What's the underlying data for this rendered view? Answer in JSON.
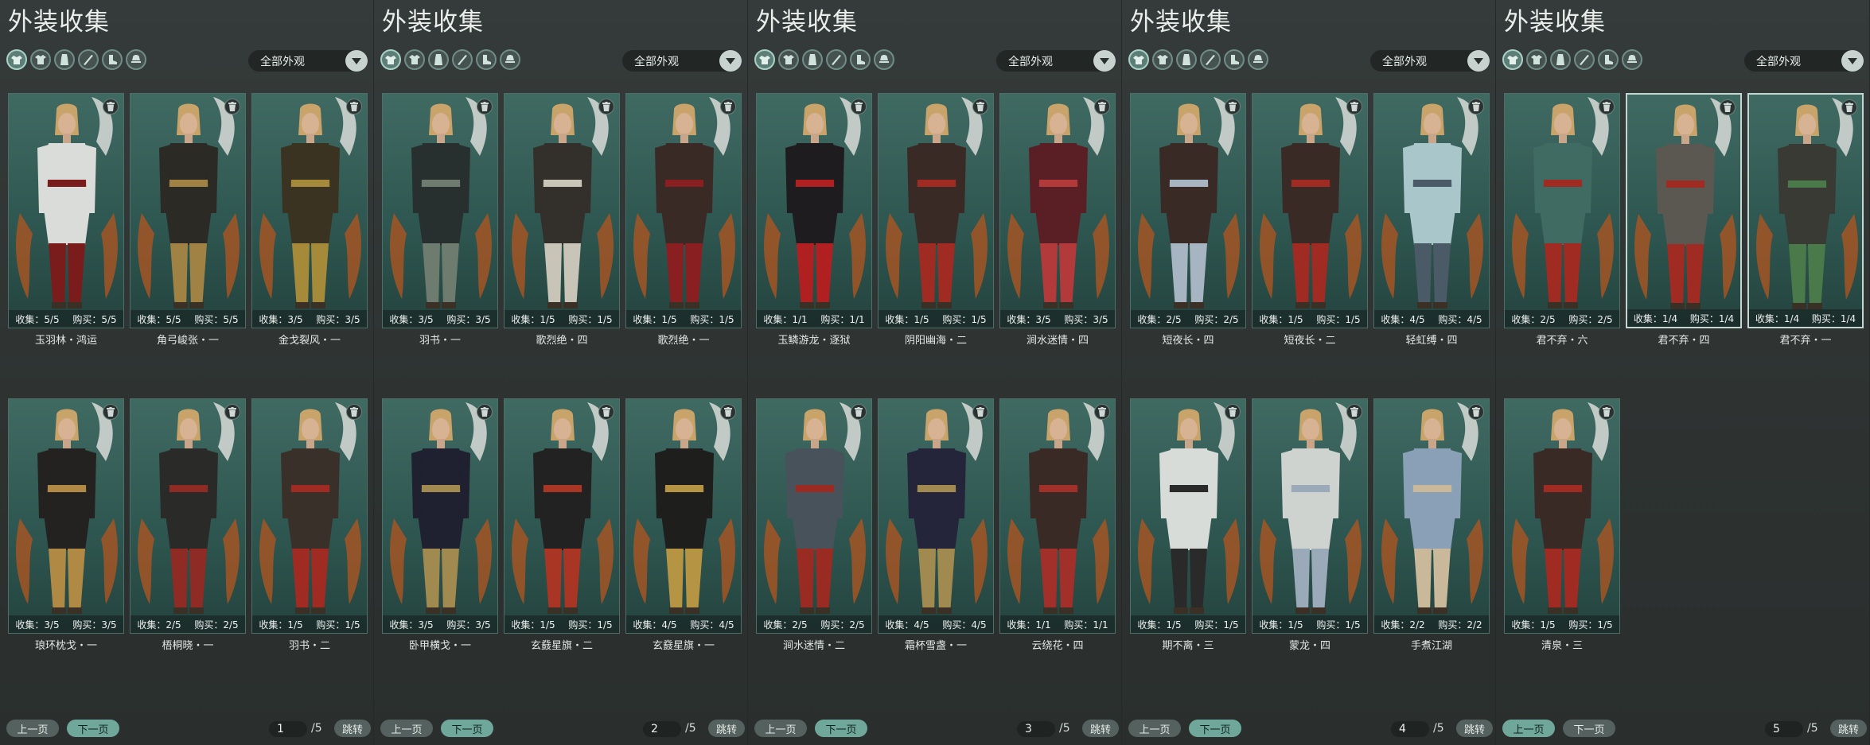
{
  "colors": {
    "background": "#2b302f",
    "card": "#2f5751",
    "accent": "#6fa89a",
    "text": "#e6ece9"
  },
  "icons": [
    "all-outfits-icon",
    "top-icon",
    "robe-icon",
    "weapon-icon",
    "boots-icon",
    "hat-icon"
  ],
  "panels": [
    {
      "title": "外装收集",
      "filter": "全部外观",
      "pager": {
        "prev": "上一页",
        "next": "下一页",
        "page": "1",
        "total": "/5",
        "jump": "跳转",
        "prev_active": false,
        "next_active": true
      },
      "cards": [
        {
          "name": "玉羽林・鸿运",
          "collect": "收集：5/5",
          "buy": "购买：5/5",
          "outfit": "#d9dcd8",
          "trim": "#7a1c1c",
          "selected": false
        },
        {
          "name": "角弓峻张・一",
          "collect": "收集：5/5",
          "buy": "购买：5/5",
          "outfit": "#2b2a25",
          "trim": "#a08344",
          "selected": false
        },
        {
          "name": "金戈裂风・一",
          "collect": "收集：3/5",
          "buy": "购买：3/5",
          "outfit": "#3a3322",
          "trim": "#a58a3a",
          "selected": false
        },
        {
          "name": "琅环枕戈・一",
          "collect": "收集：3/5",
          "buy": "购买：3/5",
          "outfit": "#242220",
          "trim": "#b08a45",
          "selected": false
        },
        {
          "name": "梧桐晓・一",
          "collect": "收集：2/5",
          "buy": "购买：2/5",
          "outfit": "#2a2a28",
          "trim": "#8e2b24",
          "selected": false
        },
        {
          "name": "羽书・二",
          "collect": "收集：1/5",
          "buy": "购买：1/5",
          "outfit": "#3a302a",
          "trim": "#9f2b22",
          "selected": false
        }
      ]
    },
    {
      "title": "外装收集",
      "filter": "全部外观",
      "pager": {
        "prev": "上一页",
        "next": "下一页",
        "page": "2",
        "total": "/5",
        "jump": "跳转",
        "prev_active": false,
        "next_active": true
      },
      "cards": [
        {
          "name": "羽书・一",
          "collect": "收集：3/5",
          "buy": "购买：3/5",
          "outfit": "#27302f",
          "trim": "#6d7c6f",
          "selected": false
        },
        {
          "name": "歌烈绝・四",
          "collect": "收集：1/5",
          "buy": "购买：1/5",
          "outfit": "#33302b",
          "trim": "#c9c4b8",
          "selected": false
        },
        {
          "name": "歌烈绝・一",
          "collect": "收集：1/5",
          "buy": "购买：1/5",
          "outfit": "#3a2a26",
          "trim": "#8a1f22",
          "selected": false
        },
        {
          "name": "卧甲横戈・一",
          "collect": "收集：3/5",
          "buy": "购买：3/5",
          "outfit": "#1f2130",
          "trim": "#a08a50",
          "selected": false
        },
        {
          "name": "玄鼗星旗・二",
          "collect": "收集：1/5",
          "buy": "购买：1/5",
          "outfit": "#222222",
          "trim": "#a93525",
          "selected": false
        },
        {
          "name": "玄鼗星旗・一",
          "collect": "收集：4/5",
          "buy": "购买：4/5",
          "outfit": "#1e1e1c",
          "trim": "#b59444",
          "selected": false
        }
      ]
    },
    {
      "title": "外装收集",
      "filter": "全部外观",
      "pager": {
        "prev": "上一页",
        "next": "下一页",
        "page": "3",
        "total": "/5",
        "jump": "跳转",
        "prev_active": false,
        "next_active": true
      },
      "cards": [
        {
          "name": "玉鳞游龙・逐狱",
          "collect": "收集：1/1",
          "buy": "购买：1/1",
          "outfit": "#1e1c1f",
          "trim": "#b02020",
          "selected": false
        },
        {
          "name": "阴阳幽海・二",
          "collect": "收集：1/5",
          "buy": "购买：1/5",
          "outfit": "#3a2a26",
          "trim": "#9f2b22",
          "selected": false
        },
        {
          "name": "涧水迷情・四",
          "collect": "收集：3/5",
          "buy": "购买：3/5",
          "outfit": "#5a1f24",
          "trim": "#b33a3a",
          "selected": false
        },
        {
          "name": "涧水迷情・二",
          "collect": "收集：2/5",
          "buy": "购买：2/5",
          "outfit": "#48525a",
          "trim": "#9a2b22",
          "selected": false
        },
        {
          "name": "霜杯雪盏・一",
          "collect": "收集：4/5",
          "buy": "购买：4/5",
          "outfit": "#24243a",
          "trim": "#a08a50",
          "selected": false
        },
        {
          "name": "云绕花・四",
          "collect": "收集：1/1",
          "buy": "购买：1/1",
          "outfit": "#3a2a26",
          "trim": "#a1302a",
          "selected": false
        }
      ]
    },
    {
      "title": "外装收集",
      "filter": "全部外观",
      "pager": {
        "prev": "上一页",
        "next": "下一页",
        "page": "4",
        "total": "/5",
        "jump": "跳转",
        "prev_active": false,
        "next_active": true
      },
      "cards": [
        {
          "name": "短夜长・四",
          "collect": "收集：2/5",
          "buy": "购买：2/5",
          "outfit": "#3a2a26",
          "trim": "#a7b5c2",
          "selected": false
        },
        {
          "name": "短夜长・二",
          "collect": "收集：1/5",
          "buy": "购买：1/5",
          "outfit": "#3a2a26",
          "trim": "#9f2b22",
          "selected": false
        },
        {
          "name": "轻虹缚・四",
          "collect": "收集：4/5",
          "buy": "购买：4/5",
          "outfit": "#a9c7cb",
          "trim": "#4a5a66",
          "selected": false
        },
        {
          "name": "期不离・三",
          "collect": "收集：1/5",
          "buy": "购买：1/5",
          "outfit": "#d8dcd8",
          "trim": "#2a2a2a",
          "selected": false
        },
        {
          "name": "蒙龙・四",
          "collect": "收集：1/5",
          "buy": "购买：1/5",
          "outfit": "#cfd3cf",
          "trim": "#9aaab8",
          "selected": false
        },
        {
          "name": "手煮江湖",
          "collect": "收集：2/2",
          "buy": "购买：2/2",
          "outfit": "#8aa0b6",
          "trim": "#c9b99a",
          "selected": false
        }
      ]
    },
    {
      "title": "外装收集",
      "filter": "全部外观",
      "pager": {
        "prev": "上一页",
        "next": "下一页",
        "page": "5",
        "total": "/5",
        "jump": "跳转",
        "prev_active": true,
        "next_active": false
      },
      "cards": [
        {
          "name": "君不弃・六",
          "collect": "收集：2/5",
          "buy": "购买：2/5",
          "outfit": "#3f6b63",
          "trim": "#9f2b22",
          "selected": false
        },
        {
          "name": "君不弃・四",
          "collect": "收集：1/4",
          "buy": "购买：1/4",
          "outfit": "#5a5850",
          "trim": "#9f2b22",
          "selected": true
        },
        {
          "name": "君不弃・一",
          "collect": "收集：1/4",
          "buy": "购买：1/4",
          "outfit": "#3a3a34",
          "trim": "#4a7a4a",
          "selected": true
        },
        {
          "name": "清泉・三",
          "collect": "收集：1/5",
          "buy": "购买：1/5",
          "outfit": "#3a2a26",
          "trim": "#9f2b22",
          "selected": false
        }
      ]
    }
  ]
}
